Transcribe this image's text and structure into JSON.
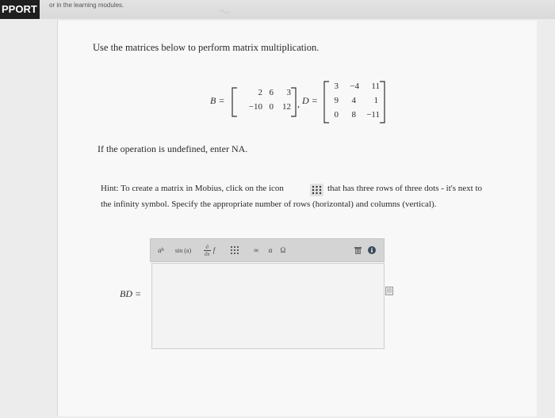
{
  "topbar": {
    "brand": "PPORT",
    "note": "or in the learning modules."
  },
  "question": {
    "prompt": "Use the matrices below to perform matrix multiplication.",
    "matrix_b": {
      "label": "B =",
      "rows": [
        [
          "2",
          "6",
          "3"
        ],
        [
          "−10",
          "0",
          "12"
        ]
      ]
    },
    "separator": ",",
    "matrix_d": {
      "label": "D =",
      "rows": [
        [
          "3",
          "−4",
          "11"
        ],
        [
          "9",
          "4",
          "1"
        ],
        [
          "0",
          "8",
          "−11"
        ]
      ]
    },
    "undefined_note": "If the operation is undefined, enter NA."
  },
  "hint": {
    "line1": "Hint: To create a matrix in Mobius, click on the icon",
    "line1_rest": "that has three rows of three dots - it's next to",
    "line2": "the infinity symbol. Specify the appropriate number of rows (horizontal) and columns (vertical)."
  },
  "editor": {
    "label": "BD =",
    "toolbar": {
      "power": "a",
      "power_sup": "b",
      "func": "sin (a)",
      "deriv_top": "∂",
      "deriv_bottom": "∂x",
      "deriv_f": "f",
      "infinity": "∞",
      "alpha": "α",
      "omega": "Ω"
    },
    "value": ""
  }
}
